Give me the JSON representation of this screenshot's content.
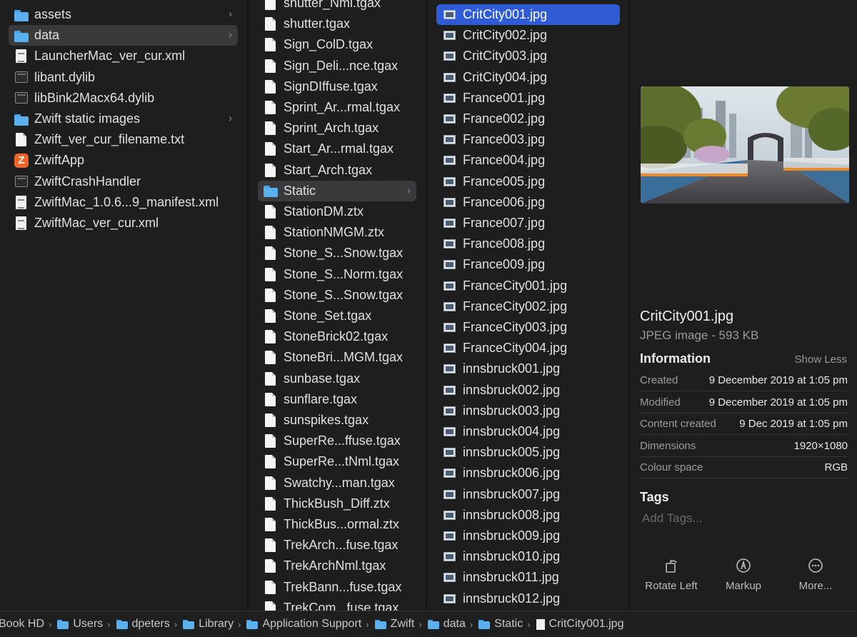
{
  "column1": {
    "items": [
      {
        "icon": "folder",
        "name": "assets",
        "chevron": true
      },
      {
        "icon": "folder",
        "name": "data",
        "chevron": true,
        "selected": true
      },
      {
        "icon": "xml",
        "name": "LauncherMac_ver_cur.xml"
      },
      {
        "icon": "term",
        "name": "libant.dylib"
      },
      {
        "icon": "term",
        "name": "libBink2Macx64.dylib"
      },
      {
        "icon": "folder",
        "name": "Zwift static images",
        "chevron": true
      },
      {
        "icon": "doc",
        "name": "Zwift_ver_cur_filename.txt"
      },
      {
        "icon": "app",
        "name": "ZwiftApp"
      },
      {
        "icon": "term",
        "name": "ZwiftCrashHandler"
      },
      {
        "icon": "xml",
        "name": "ZwiftMac_1.0.6...9_manifest.xml"
      },
      {
        "icon": "xml",
        "name": "ZwiftMac_ver_cur.xml"
      }
    ]
  },
  "column2": {
    "items": [
      {
        "icon": "doc",
        "name": "shutter_Nml.tgax"
      },
      {
        "icon": "doc",
        "name": "shutter.tgax"
      },
      {
        "icon": "doc",
        "name": "Sign_ColD.tgax"
      },
      {
        "icon": "doc",
        "name": "Sign_Deli...nce.tgax"
      },
      {
        "icon": "doc",
        "name": "SignDIffuse.tgax"
      },
      {
        "icon": "doc",
        "name": "Sprint_Ar...rmal.tgax"
      },
      {
        "icon": "doc",
        "name": "Sprint_Arch.tgax"
      },
      {
        "icon": "doc",
        "name": "Start_Ar...rmal.tgax"
      },
      {
        "icon": "doc",
        "name": "Start_Arch.tgax"
      },
      {
        "icon": "folder",
        "name": "Static",
        "chevron": true,
        "selected": true
      },
      {
        "icon": "doc",
        "name": "StationDM.ztx"
      },
      {
        "icon": "doc",
        "name": "StationNMGM.ztx"
      },
      {
        "icon": "doc",
        "name": "Stone_S...Snow.tgax"
      },
      {
        "icon": "doc",
        "name": "Stone_S...Norm.tgax"
      },
      {
        "icon": "doc",
        "name": "Stone_S...Snow.tgax"
      },
      {
        "icon": "doc",
        "name": "Stone_Set.tgax"
      },
      {
        "icon": "doc",
        "name": "StoneBrick02.tgax"
      },
      {
        "icon": "doc",
        "name": "StoneBri...MGM.tgax"
      },
      {
        "icon": "doc",
        "name": "sunbase.tgax"
      },
      {
        "icon": "doc",
        "name": "sunflare.tgax"
      },
      {
        "icon": "doc",
        "name": "sunspikes.tgax"
      },
      {
        "icon": "doc",
        "name": "SuperRe...ffuse.tgax"
      },
      {
        "icon": "doc",
        "name": "SuperRe...tNml.tgax"
      },
      {
        "icon": "doc",
        "name": "Swatchy...man.tgax"
      },
      {
        "icon": "doc",
        "name": "ThickBush_Diff.ztx"
      },
      {
        "icon": "doc",
        "name": "ThickBus...ormal.ztx"
      },
      {
        "icon": "doc",
        "name": "TrekArch...fuse.tgax"
      },
      {
        "icon": "doc",
        "name": "TrekArchNml.tgax"
      },
      {
        "icon": "doc",
        "name": "TrekBann...fuse.tgax"
      },
      {
        "icon": "doc",
        "name": "TrekCom...fuse.tgax"
      }
    ]
  },
  "column3": {
    "items": [
      {
        "icon": "img",
        "name": "CritCity001.jpg",
        "selected": true
      },
      {
        "icon": "img",
        "name": "CritCity002.jpg"
      },
      {
        "icon": "img",
        "name": "CritCity003.jpg"
      },
      {
        "icon": "img",
        "name": "CritCity004.jpg"
      },
      {
        "icon": "img",
        "name": "France001.jpg"
      },
      {
        "icon": "img",
        "name": "France002.jpg"
      },
      {
        "icon": "img",
        "name": "France003.jpg"
      },
      {
        "icon": "img",
        "name": "France004.jpg"
      },
      {
        "icon": "img",
        "name": "France005.jpg"
      },
      {
        "icon": "img",
        "name": "France006.jpg"
      },
      {
        "icon": "img",
        "name": "France007.jpg"
      },
      {
        "icon": "img",
        "name": "France008.jpg"
      },
      {
        "icon": "img",
        "name": "France009.jpg"
      },
      {
        "icon": "img",
        "name": "FranceCity001.jpg"
      },
      {
        "icon": "img",
        "name": "FranceCity002.jpg"
      },
      {
        "icon": "img",
        "name": "FranceCity003.jpg"
      },
      {
        "icon": "img",
        "name": "FranceCity004.jpg"
      },
      {
        "icon": "img",
        "name": "innsbruck001.jpg"
      },
      {
        "icon": "img",
        "name": "innsbruck002.jpg"
      },
      {
        "icon": "img",
        "name": "innsbruck003.jpg"
      },
      {
        "icon": "img",
        "name": "innsbruck004.jpg"
      },
      {
        "icon": "img",
        "name": "innsbruck005.jpg"
      },
      {
        "icon": "img",
        "name": "innsbruck006.jpg"
      },
      {
        "icon": "img",
        "name": "innsbruck007.jpg"
      },
      {
        "icon": "img",
        "name": "innsbruck008.jpg"
      },
      {
        "icon": "img",
        "name": "innsbruck009.jpg"
      },
      {
        "icon": "img",
        "name": "innsbruck010.jpg"
      },
      {
        "icon": "img",
        "name": "innsbruck011.jpg"
      },
      {
        "icon": "img",
        "name": "innsbruck012.jpg"
      }
    ]
  },
  "preview": {
    "filename": "CritCity001.jpg",
    "kind_size": "JPEG image - 593 KB",
    "information_label": "Information",
    "show_less_label": "Show Less",
    "info": [
      {
        "key": "Created",
        "value": "9 December 2019 at 1:05 pm"
      },
      {
        "key": "Modified",
        "value": "9 December 2019 at 1:05 pm"
      },
      {
        "key": "Content created",
        "value": "9 Dec 2019 at 1:05 pm"
      },
      {
        "key": "Dimensions",
        "value": "1920×1080"
      },
      {
        "key": "Colour space",
        "value": "RGB"
      }
    ],
    "tags_label": "Tags",
    "tags_placeholder": "Add Tags...",
    "actions": [
      {
        "label": "Rotate Left",
        "icon": "rotate-left-icon"
      },
      {
        "label": "Markup",
        "icon": "markup-icon"
      },
      {
        "label": "More...",
        "icon": "more-icon"
      }
    ]
  },
  "pathbar": {
    "crumbs": [
      {
        "label": "Book HD",
        "icon": "none"
      },
      {
        "label": "Users",
        "icon": "folder"
      },
      {
        "label": "dpeters",
        "icon": "folder"
      },
      {
        "label": "Library",
        "icon": "folder"
      },
      {
        "label": "Application Support",
        "icon": "folder"
      },
      {
        "label": "Zwift",
        "icon": "folder"
      },
      {
        "label": "data",
        "icon": "folder"
      },
      {
        "label": "Static",
        "icon": "folder"
      },
      {
        "label": "CritCity001.jpg",
        "icon": "doc"
      }
    ]
  },
  "colors": {
    "background": "#1e1e1e",
    "selection_blue": "#2f5bd6",
    "selection_gray": "#3a3a3c",
    "folder_blue": "#5bb1ee",
    "zwift_orange": "#f0642a"
  }
}
